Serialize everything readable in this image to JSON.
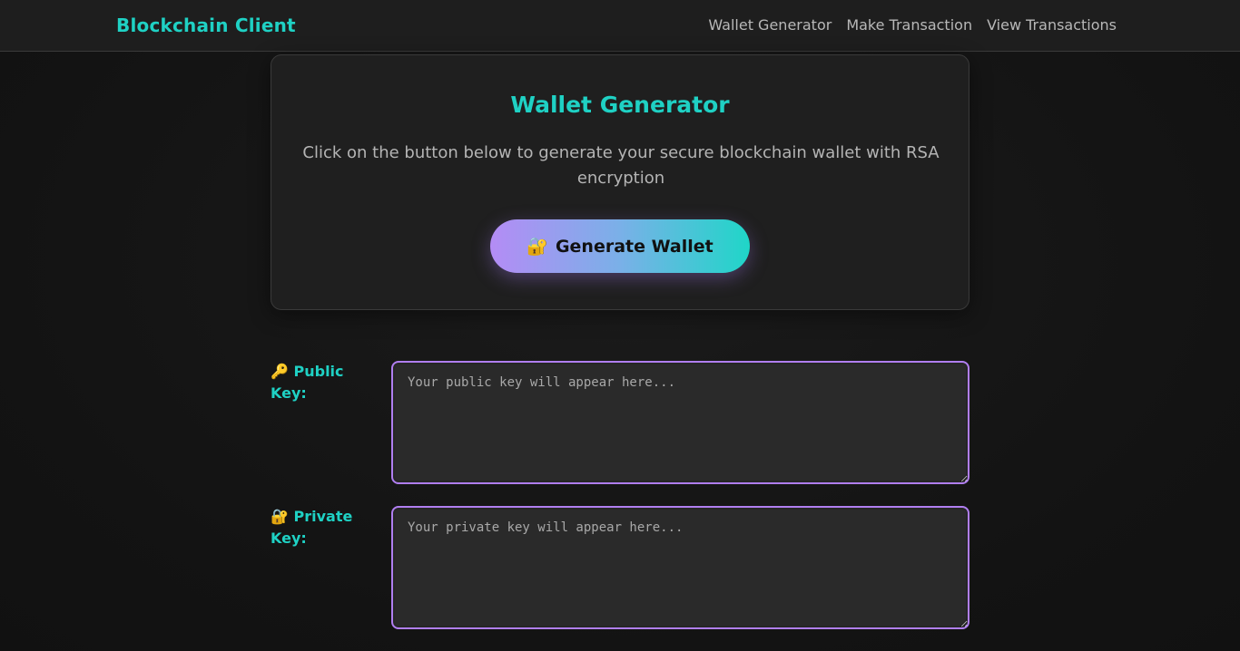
{
  "navbar": {
    "brand": "Blockchain Client",
    "links": [
      "Wallet Generator",
      "Make Transaction",
      "View Transactions"
    ]
  },
  "card": {
    "title": "Wallet Generator",
    "description": "Click on the button below to generate your secure blockchain wallet with RSA encryption",
    "button_icon": "🔐",
    "button_label": "Generate Wallet"
  },
  "fields": {
    "public": {
      "icon": "🔑",
      "label": "Public Key:",
      "placeholder": "Your public key will appear here..."
    },
    "private": {
      "icon": "🔐",
      "label": "Private Key:",
      "placeholder": "Your private key will appear here..."
    }
  },
  "colors": {
    "accent": "#1fd1c4",
    "border_purple": "#b07ef0"
  }
}
